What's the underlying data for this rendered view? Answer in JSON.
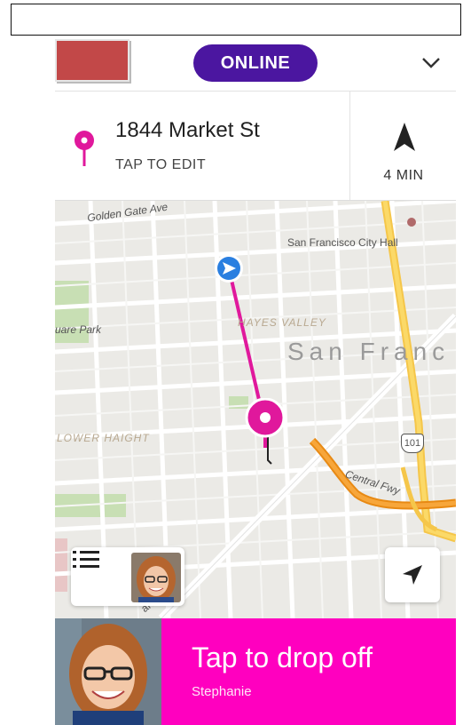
{
  "status_badge": "ONLINE",
  "destination": {
    "address": "1844 Market St",
    "hint": "TAP TO EDIT"
  },
  "eta": {
    "label": "4 MIN"
  },
  "map": {
    "labels": {
      "golden_gate": "Golden Gate Ave",
      "city_hall": "San Francisco City Hall",
      "hayes_valley": "HAYES VALLEY",
      "city": "San Franc",
      "park": "uare Park",
      "lower_haight": "LOWER HAIGHT",
      "central_fwy": "Central Fwy",
      "highway": "101",
      "street_partial": "arke"
    }
  },
  "action": {
    "title": "Tap to drop off",
    "rider_name": "Stephanie"
  },
  "colors": {
    "brand_purple": "#4b16a0",
    "accent_pink": "#ff00bf",
    "route": "#e0189c"
  },
  "icons": [
    "chevron-down-icon",
    "location-pin-icon",
    "navigation-arrow-icon",
    "list-icon",
    "locate-me-icon",
    "driver-location-icon"
  ]
}
